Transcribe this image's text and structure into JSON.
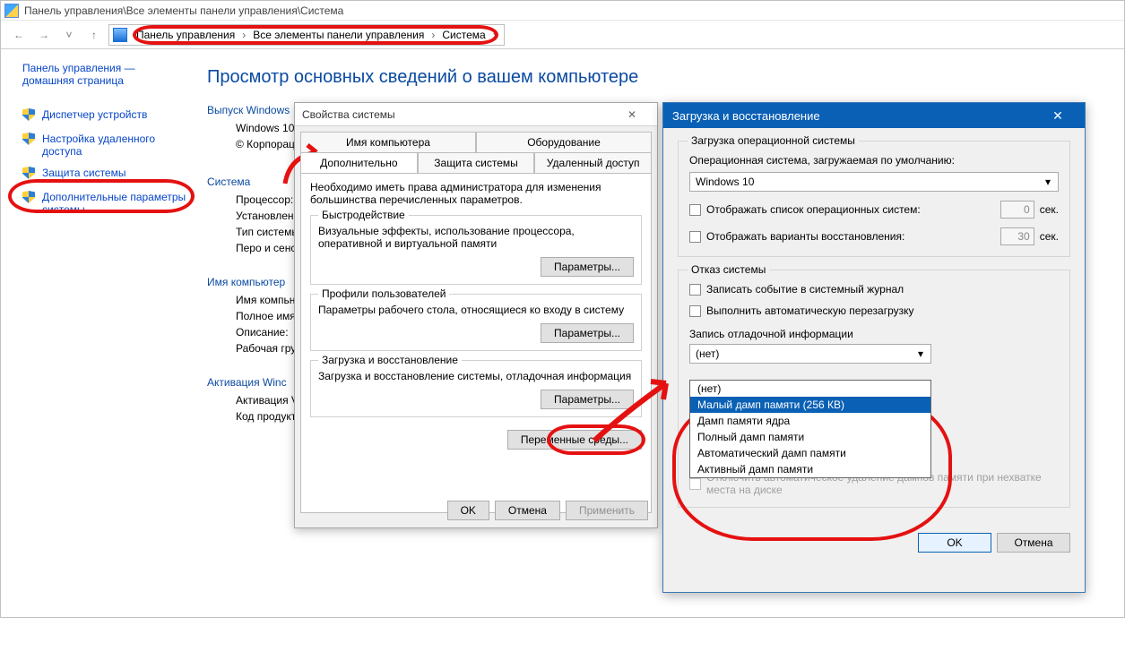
{
  "window": {
    "title": "Панель управления\\Все элементы панели управления\\Система",
    "breadcrumb": [
      "Панель управления",
      "Все элементы панели управления",
      "Система"
    ]
  },
  "sidebar": {
    "home": "Панель управления — домашняя страница",
    "items": [
      "Диспетчер устройств",
      "Настройка удаленного доступа",
      "Защита системы",
      "Дополнительные параметры системы"
    ]
  },
  "main": {
    "h1": "Просмотр основных сведений о вашем компьютере",
    "group1_label": "Выпуск Windows",
    "win_edition": "Windows 10",
    "copyright": "© Корпорац",
    "group2_label": "Система",
    "rows2": {
      "cpu": "Процессор:",
      "ram": "Установленн (ОЗУ):",
      "type": "Тип системы",
      "pen": "Перо и сенс"
    },
    "group3_label": "Имя компьютер",
    "rows3": {
      "name": "Имя компьн",
      "full": "Полное имя",
      "desc": "Описание:",
      "wg": "Рабочая гру"
    },
    "group4_label": "Активация Winc",
    "rows4": {
      "act": "Активация V",
      "pk": "Код продукт"
    }
  },
  "dlg1": {
    "title": "Свойства системы",
    "tabs_top": [
      "Имя компьютера",
      "Оборудование"
    ],
    "tabs_bottom": [
      "Дополнительно",
      "Защита системы",
      "Удаленный доступ"
    ],
    "intro": "Необходимо иметь права администратора для изменения большинства перечисленных параметров.",
    "fs1": {
      "legend": "Быстродействие",
      "text": "Визуальные эффекты, использование процессора, оперативной и виртуальной памяти",
      "btn": "Параметры..."
    },
    "fs2": {
      "legend": "Профили пользователей",
      "text": "Параметры рабочего стола, относящиеся ко входу в систему",
      "btn": "Параметры..."
    },
    "fs3": {
      "legend": "Загрузка и восстановление",
      "text": "Загрузка и восстановление системы, отладочная информация",
      "btn": "Параметры..."
    },
    "env_btn": "Переменные среды...",
    "ok": "OK",
    "cancel": "Отмена",
    "apply": "Применить"
  },
  "dlg2": {
    "title": "Загрузка и восстановление",
    "boot": {
      "legend": "Загрузка операционной системы",
      "os_label": "Операционная система, загружаемая по умолчанию:",
      "os_value": "Windows 10",
      "chk_list": "Отображать список операционных систем:",
      "chk_list_sec": "0",
      "sec_label": "сек.",
      "chk_recov": "Отображать варианты восстановления:",
      "chk_recov_sec": "30"
    },
    "fail": {
      "legend": "Отказ системы",
      "chk_log": "Записать событие в системный журнал",
      "chk_restart": "Выполнить автоматическую перезагрузку",
      "dump_label": "Запись отладочной информации",
      "dump_value": "(нет)",
      "dump_options": [
        "(нет)",
        "Малый дамп памяти (256 КВ)",
        "Дамп памяти ядра",
        "Полный дамп памяти",
        "Автоматический дамп памяти",
        "Активный дамп памяти"
      ],
      "disable_del": "Отключить автоматическое удаление дампов памяти при нехватке места на диске"
    },
    "ok": "OK",
    "cancel": "Отмена"
  }
}
